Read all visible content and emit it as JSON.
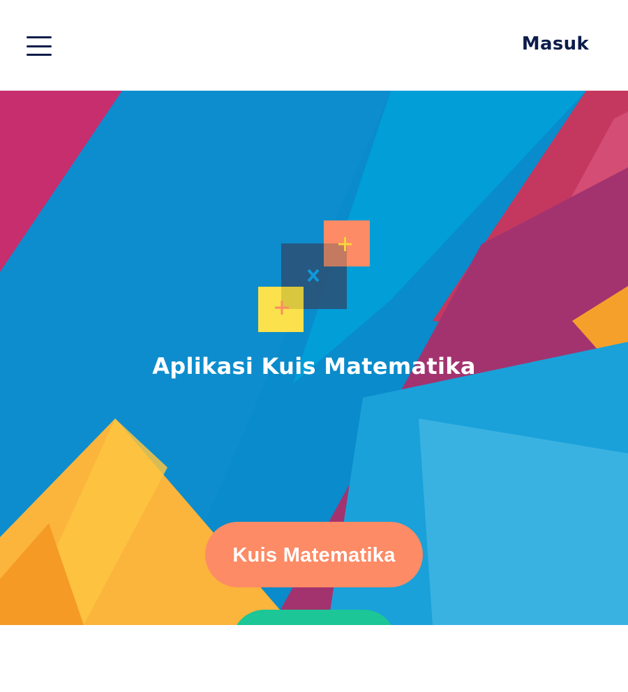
{
  "header": {
    "menu_icon": "hamburger-menu-icon",
    "login_label": "Masuk",
    "text_color": "#0d1c4a"
  },
  "hero": {
    "logo_icon": "math-symbols-logo-icon",
    "title": "Aplikasi Kuis Matematika",
    "primary_button_label": "Kuis Matematika",
    "primary_button_color": "#fc8b66",
    "secondary_button_color": "#1cc696"
  }
}
